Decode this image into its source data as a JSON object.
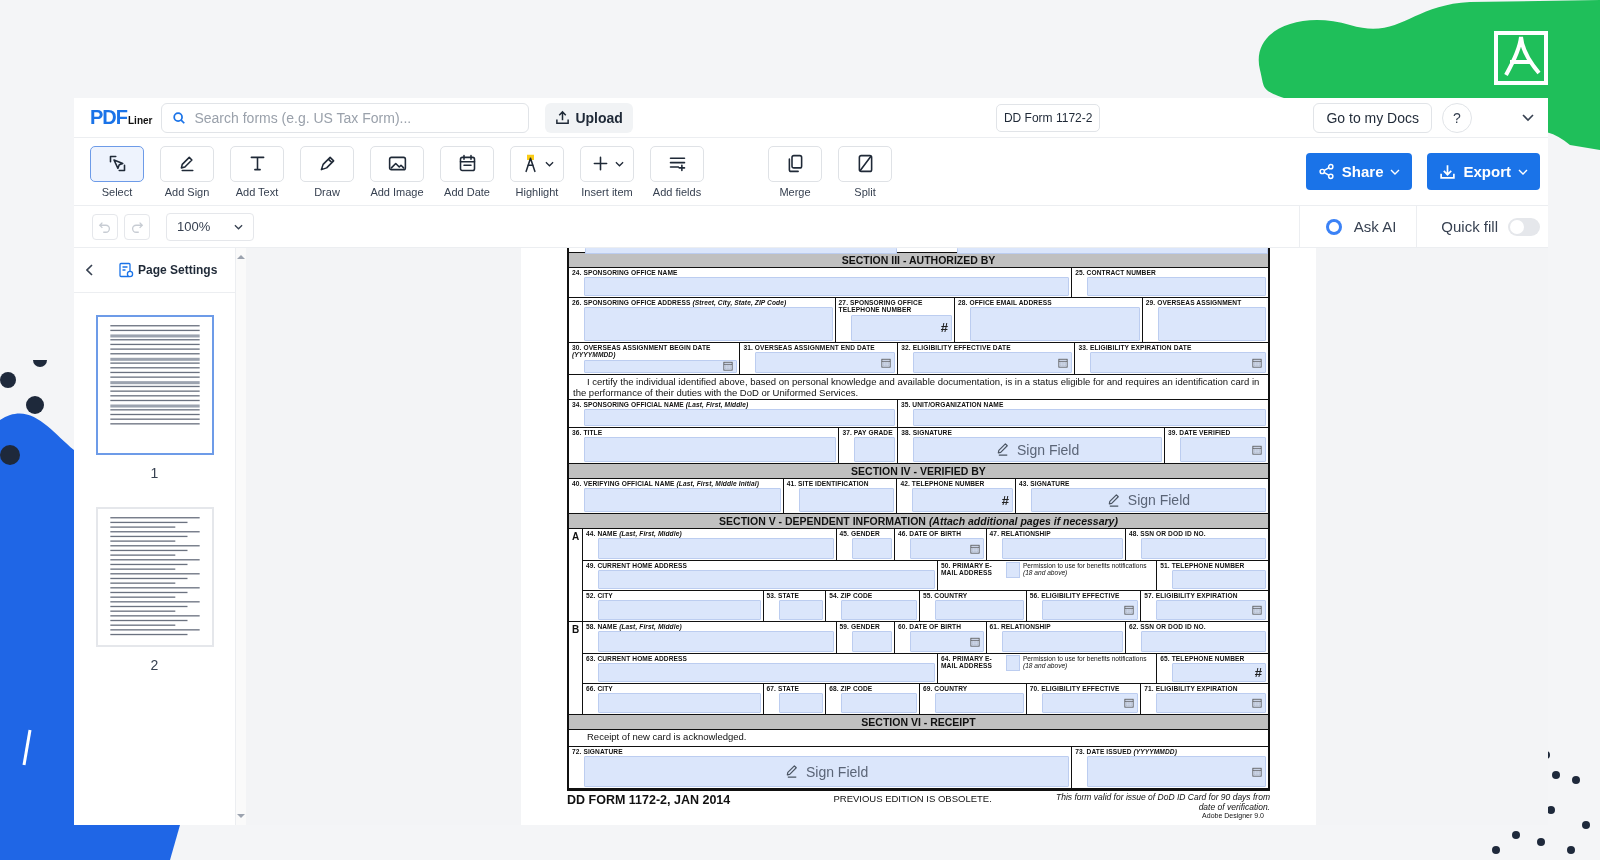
{
  "topbar": {
    "logo": "PDF",
    "logo_sub": "Liner",
    "search": {
      "placeholder": "Search forms (e.g. US Tax Form)..."
    },
    "upload": "Upload",
    "document_title": "DD Form 1172-2",
    "docs_button": "Go to my Docs",
    "help": "?"
  },
  "tools": [
    {
      "kind": "select",
      "label": "Select",
      "selected": true,
      "caret": false
    },
    {
      "kind": "sign",
      "label": "Add Sign",
      "selected": false,
      "caret": false
    },
    {
      "kind": "text",
      "label": "Add Text",
      "selected": false,
      "caret": false
    },
    {
      "kind": "draw",
      "label": "Draw",
      "selected": false,
      "caret": false
    },
    {
      "kind": "image",
      "label": "Add Image",
      "selected": false,
      "caret": false
    },
    {
      "kind": "date",
      "label": "Add Date",
      "selected": false,
      "caret": false
    },
    {
      "kind": "highlight",
      "label": "Highlight",
      "selected": false,
      "caret": true
    },
    {
      "kind": "insert",
      "label": "Insert item",
      "selected": false,
      "caret": true
    },
    {
      "kind": "fields",
      "label": "Add fields",
      "selected": false,
      "caret": false
    }
  ],
  "page_tools": [
    {
      "kind": "merge",
      "label": "Merge",
      "selected": false,
      "caret": false
    },
    {
      "kind": "split",
      "label": "Split",
      "selected": false,
      "caret": false
    }
  ],
  "share": "Share",
  "export": "Export",
  "history": [
    {
      "kind": "undo",
      "disabled": true
    },
    {
      "kind": "redo",
      "disabled": true
    }
  ],
  "zoom": "100%",
  "ask_ai": "Ask AI",
  "quick_fill": {
    "label": "Quick fill",
    "on": false
  },
  "sidebar": {
    "title": "Page Settings",
    "pages": [
      {
        "label": "1",
        "selected": true
      },
      {
        "label": "2",
        "selected": false
      }
    ]
  },
  "form": {
    "rows": [
      {
        "kind": "header",
        "title": "SECTION III - AUTHORIZED BY"
      },
      {
        "kind": "fields",
        "cells": [
          {
            "label": "24. SPONSORING OFFICE NAME",
            "kind": "text"
          },
          {
            "label": "25. CONTRACT NUMBER",
            "kind": "text"
          }
        ]
      },
      {
        "kind": "fields",
        "cells": [
          {
            "label": "26. SPONSORING OFFICE ADDRESS *(Street, City, State, ZIP Code)*",
            "kind": "text"
          },
          {
            "label": "27. SPONSORING OFFICE TELEPHONE NUMBER",
            "kind": "phone",
            "suffix": "#"
          },
          {
            "label": "28. OFFICE EMAIL ADDRESS",
            "kind": "text"
          },
          {
            "label": "29. OVERSEAS ASSIGNMENT",
            "kind": "text"
          }
        ]
      },
      {
        "kind": "fields",
        "cells": [
          {
            "label": "30. OVERSEAS ASSIGNMENT BEGIN DATE *(YYYYMMDD)*",
            "kind": "date"
          },
          {
            "label": "31. OVERSEAS ASSIGNMENT END DATE",
            "kind": "date"
          },
          {
            "label": "32. ELIGIBILITY EFFECTIVE DATE",
            "kind": "date"
          },
          {
            "label": "33. ELIGIBILITY EXPIRATION DATE",
            "kind": "date"
          }
        ]
      },
      {
        "kind": "text",
        "text": "I certify the individual identified above, based on personal knowledge and available documentation, is in a status eligible for and requires an identification card in the performance of their duties with the DoD or Uniformed Services."
      },
      {
        "kind": "fields",
        "cells": [
          {
            "label": "34. SPONSORING OFFICIAL NAME *(Last, First, Middle)*",
            "kind": "text"
          },
          {
            "label": "35. UNIT/ORGANIZATION NAME",
            "kind": "text"
          }
        ]
      },
      {
        "kind": "fields",
        "cells": [
          {
            "label": "36. TITLE",
            "kind": "text"
          },
          {
            "label": "37. PAY GRADE",
            "kind": "text"
          },
          {
            "label": "38. SIGNATURE",
            "kind": "sign",
            "button": "Sign Field"
          },
          {
            "label": "39. DATE VERIFIED",
            "kind": "date"
          }
        ]
      },
      {
        "kind": "header",
        "title": "SECTION IV - VERIFIED BY"
      },
      {
        "kind": "fields",
        "cells": [
          {
            "label": "40. VERIFYING OFFICIAL NAME *(Last, First, Middle Initial)*",
            "kind": "text"
          },
          {
            "label": "41. SITE IDENTIFICATION",
            "kind": "text"
          },
          {
            "label": "42. TELEPHONE NUMBER",
            "kind": "phone",
            "suffix": "#"
          },
          {
            "label": "43. SIGNATURE",
            "kind": "sign",
            "button": "Sign Field"
          }
        ]
      },
      {
        "kind": "header",
        "title": "SECTION V - DEPENDENT INFORMATION *(Attach additional pages if necessary)*"
      },
      {
        "kind": "dependent",
        "letter": "A",
        "lines": [
          {
            "cells": [
              {
                "label": "44. NAME *(Last, First, Middle)*",
                "kind": "text"
              },
              {
                "label": "45. GENDER",
                "kind": "text"
              },
              {
                "label": "46. DATE OF BIRTH",
                "kind": "date"
              },
              {
                "label": "47. RELATIONSHIP",
                "kind": "text"
              },
              {
                "label": "48. SSN OR DOD ID NO.",
                "kind": "text"
              }
            ]
          },
          {
            "cells": [
              {
                "label": "49. CURRENT HOME ADDRESS",
                "kind": "text"
              },
              {
                "label": "50. PRIMARY E-MAIL ADDRESS",
                "kind": "consent",
                "checked": false,
                "note": "Permission to use for benefits notifications *(18 and above)*"
              },
              {
                "label": "51. TELEPHONE NUMBER",
                "kind": "text"
              }
            ]
          },
          {
            "cells": [
              {
                "label": "52. CITY",
                "kind": "text"
              },
              {
                "label": "53. STATE",
                "kind": "text"
              },
              {
                "label": "54. ZIP CODE",
                "kind": "text"
              },
              {
                "label": "55. COUNTRY",
                "kind": "text"
              },
              {
                "label": "56. ELIGIBILITY EFFECTIVE",
                "kind": "date"
              },
              {
                "label": "57. ELIGIBILITY EXPIRATION",
                "kind": "date"
              }
            ]
          }
        ]
      },
      {
        "kind": "dependent",
        "letter": "B",
        "lines": [
          {
            "cells": [
              {
                "label": "58. NAME *(Last, First, Middle)*",
                "kind": "text"
              },
              {
                "label": "59. GENDER",
                "kind": "text"
              },
              {
                "label": "60. DATE OF BIRTH",
                "kind": "date"
              },
              {
                "label": "61. RELATIONSHIP",
                "kind": "text"
              },
              {
                "label": "62. SSN OR DOD ID NO.",
                "kind": "text"
              }
            ]
          },
          {
            "cells": [
              {
                "label": "63. CURRENT HOME ADDRESS",
                "kind": "text"
              },
              {
                "label": "64. PRIMARY E-MAIL ADDRESS",
                "kind": "consent",
                "checked": false,
                "note": "Permission to use for benefits notifications *(18 and above)*"
              },
              {
                "label": "65. TELEPHONE NUMBER",
                "kind": "phone",
                "suffix": "#"
              }
            ]
          },
          {
            "cells": [
              {
                "label": "66. CITY",
                "kind": "text"
              },
              {
                "label": "67. STATE",
                "kind": "text"
              },
              {
                "label": "68. ZIP CODE",
                "kind": "text"
              },
              {
                "label": "69. COUNTRY",
                "kind": "text"
              },
              {
                "label": "70. ELIGIBILITY EFFECTIVE",
                "kind": "date"
              },
              {
                "label": "71. ELIGIBILITY EXPIRATION",
                "kind": "date"
              }
            ]
          }
        ]
      },
      {
        "kind": "header",
        "title": "SECTION VI - RECEIPT"
      },
      {
        "kind": "text",
        "text": "Receipt of new card is acknowledged."
      },
      {
        "kind": "fields",
        "cells": [
          {
            "label": "72. SIGNATURE",
            "kind": "sign",
            "button": "Sign Field"
          },
          {
            "label": "73. DATE ISSUED *(YYYYMMDD)*",
            "kind": "date"
          }
        ]
      }
    ],
    "footer": {
      "form_id": "DD FORM 1172-2, JAN 2014",
      "edition": "PREVIOUS EDITION IS OBSOLETE.",
      "validity": "This form valid for issue of DoD ID Card for 90 days from date of verification.",
      "software": "Adobe Designer 9.0"
    }
  }
}
